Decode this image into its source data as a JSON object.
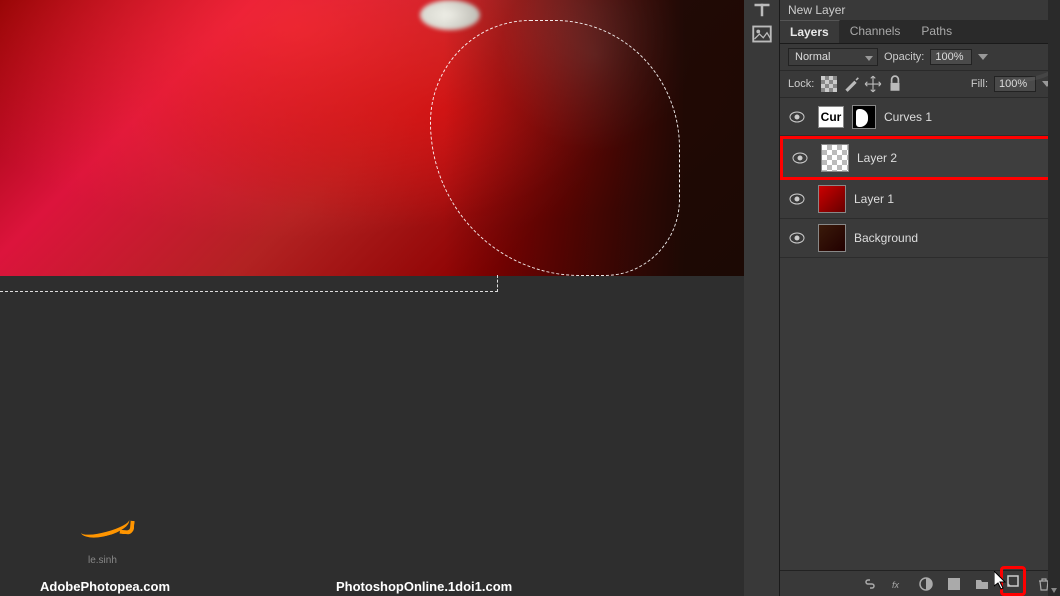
{
  "panel": {
    "title": "New Layer",
    "tabs": [
      "Layers",
      "Channels",
      "Paths"
    ],
    "active_tab": 0,
    "blend_mode": "Normal",
    "opacity_label": "Opacity:",
    "opacity_value": "100%",
    "lock_label": "Lock:",
    "fill_label": "Fill:",
    "fill_value": "100%"
  },
  "layers": [
    {
      "name": "Curves 1",
      "thumb_text": "Cur",
      "type": "adjustment",
      "visible": true,
      "selected": false
    },
    {
      "name": "Layer 2",
      "type": "transparent",
      "visible": true,
      "selected": true
    },
    {
      "name": "Layer 1",
      "type": "image-red",
      "visible": true,
      "selected": false
    },
    {
      "name": "Background",
      "type": "image-dark",
      "visible": true,
      "selected": false
    }
  ],
  "watermark": {
    "small_text": "le.sinh",
    "bottom_left": "AdobePhotopea.com",
    "bottom_center": "PhotoshopOnline.1doi1.com"
  },
  "highlight_color": "#ff0000"
}
